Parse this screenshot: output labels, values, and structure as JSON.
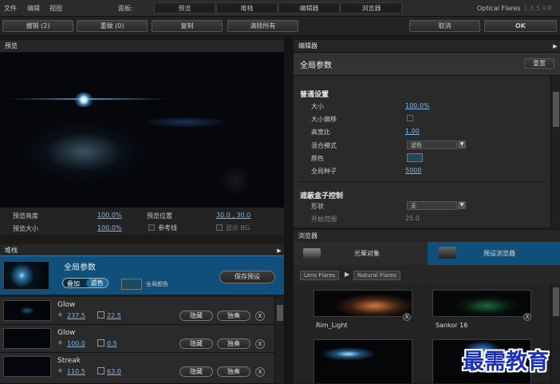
{
  "menubar": {
    "items": [
      "文件",
      "编辑",
      "视图"
    ],
    "panel_label": "面板:",
    "tabs": [
      "预览",
      "堆栈",
      "编辑器",
      "浏览器"
    ],
    "app_name": "Optical Flares",
    "version": "1.3.5 V.R"
  },
  "toolbar": {
    "undo": "撤销 (2)",
    "redo": "重做 (0)",
    "copy": "复制",
    "clear_all": "清除所有",
    "cancel": "取消",
    "ok": "OK"
  },
  "preview": {
    "title": "预览",
    "brightness_label": "预览亮度",
    "brightness_value": "100.0%",
    "position_label": "预览位置",
    "position_value": "30.0 , 30.0",
    "size_label": "预览大小",
    "size_value": "100.0%",
    "reference_label": "参考线",
    "show_bg_label": "显示 BG"
  },
  "stack": {
    "title": "堆栈",
    "global_label": "全局参数",
    "add_label": "叠加",
    "filter_label": "滤色",
    "global_color_label": "全局颜色",
    "save_preset": "保存预设",
    "rows": [
      {
        "name": "Glow",
        "v1": "237.5",
        "v2": "22.5",
        "hide": "隐藏",
        "solo": "独奏",
        "close": "X"
      },
      {
        "name": "Glow",
        "v1": "100.0",
        "v2": "0.5",
        "hide": "隐藏",
        "solo": "独奏",
        "close": "X"
      },
      {
        "name": "Streak",
        "v1": "110.5",
        "v2": "63.0",
        "hide": "隐藏",
        "solo": "独奏",
        "close": "X"
      }
    ]
  },
  "editor": {
    "title": "编辑器",
    "header": "全局参数",
    "reset": "重置",
    "general_title": "普通设置",
    "size_label": "大小",
    "size_value": "100.0%",
    "size_offset_label": "大小偏移",
    "aspect_label": "高宽比",
    "aspect_value": "1.00",
    "blend_label": "混合模式",
    "blend_value": "滤色",
    "color_label": "颜色",
    "seed_label": "全局种子",
    "seed_value": "5000",
    "mask_title": "遮蔽盒子控制",
    "shape_label": "形状",
    "shape_value": "无",
    "range_label": "开始范围",
    "range_value": "25.0"
  },
  "browser": {
    "title": "浏览器",
    "tab_objects": "光晕对象",
    "tab_presets": "预设浏览器",
    "crumb1": "Lens Flares",
    "crumb2": "Natural Flares",
    "tiles": [
      "Rim_Light",
      "Sankor 16",
      "",
      ""
    ],
    "close": "X"
  },
  "watermark": "最需教育",
  "colors": {
    "accent": "#0f4f7a",
    "link": "#7fb7e6"
  }
}
